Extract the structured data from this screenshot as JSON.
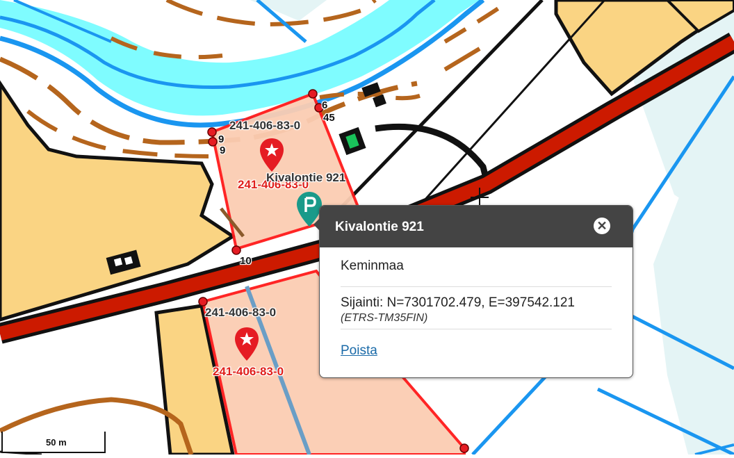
{
  "map": {
    "parcel_labels": {
      "upper": "241-406-83-0",
      "upper_red": "241-406-83-0",
      "lower": "241-406-83-0",
      "lower_red": "241-406-83-0"
    },
    "address_label": "Kivalontie 921",
    "point_numbers": {
      "n6": "6",
      "n45": "45",
      "n9a": "9",
      "n9b": "9",
      "n10": "10"
    },
    "colors": {
      "water": "#7ffcff",
      "river_edge": "#1a96f0",
      "contour": "#b5651d",
      "road": "#cc1a00",
      "field": "#fad483",
      "parcel_fill": "#fbcdb3",
      "parcel_border": "#ff1a1a",
      "blue_line": "#1a96f0",
      "marker_red": "#e51c23",
      "marker_teal": "#1a9a8a"
    }
  },
  "popup": {
    "title": "Kivalontie 921",
    "close_icon": "close-icon",
    "municipality": "Keminmaa",
    "location_text": "Sijainti: N=7301702.479, E=397542.121",
    "crs": "(ETRS-TM35FIN)",
    "remove_link": "Poista"
  },
  "scalebar": {
    "label": "50 m"
  }
}
